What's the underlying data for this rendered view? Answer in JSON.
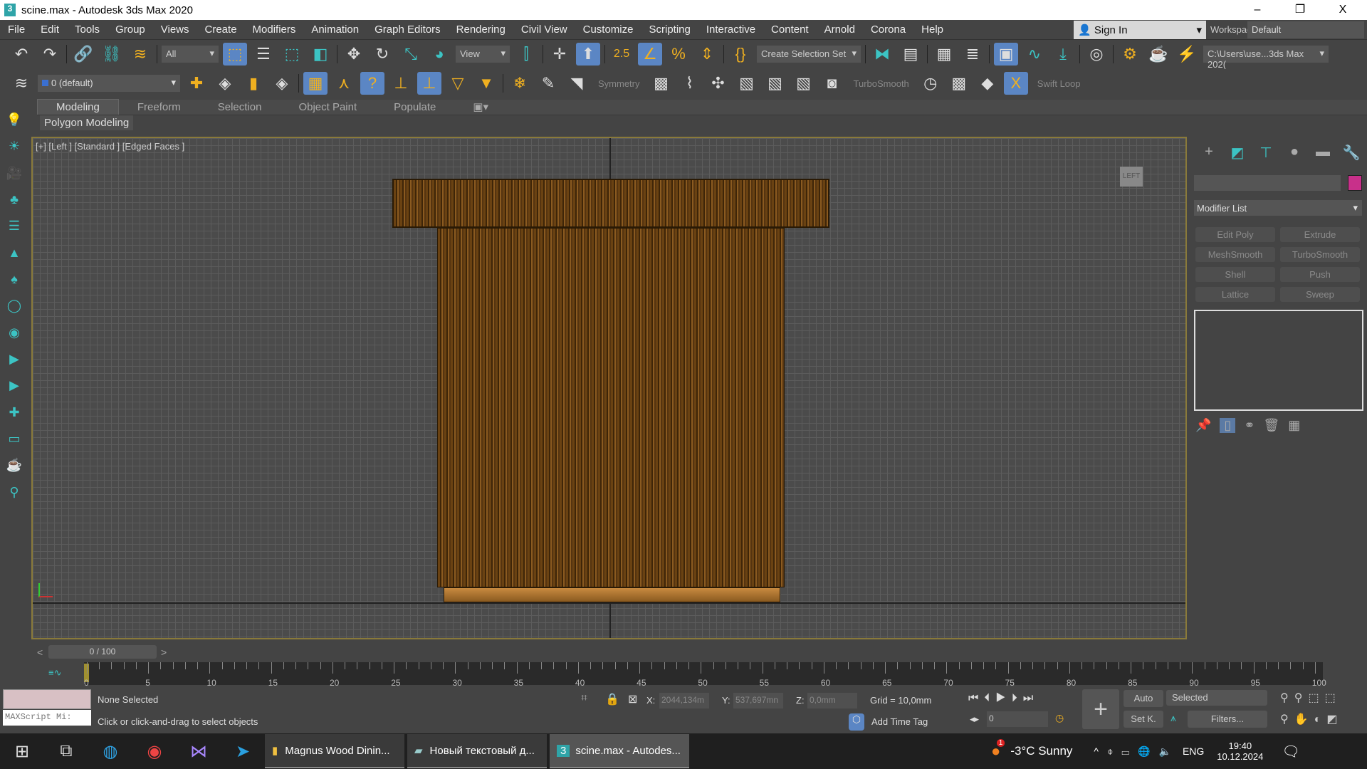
{
  "window": {
    "title": "scine.max - Autodesk 3ds Max 2020",
    "logo": "3",
    "minimize": "–",
    "restore": "❐",
    "close": "X"
  },
  "menu": [
    "File",
    "Edit",
    "Tools",
    "Group",
    "Views",
    "Create",
    "Modifiers",
    "Animation",
    "Graph Editors",
    "Rendering",
    "Civil View",
    "Customize",
    "Scripting",
    "Interactive",
    "Content",
    "Arnold",
    "Corona",
    "Help"
  ],
  "account": {
    "sign_in": "Sign In",
    "workspaces_label": "Workspaces:",
    "workspace": "Default"
  },
  "toolbar": {
    "filter": "All",
    "ref_coord": "View",
    "selection_set": "Create Selection Set",
    "project_path": "C:\\Users\\use...3ds Max 202(",
    "snap_2_5": "2.5"
  },
  "toolbar2": {
    "layer": "0 (default)",
    "symmetry": "Symmetry",
    "turbosmooth": "TurboSmooth",
    "swift_loop": "Swift Loop"
  },
  "ribbon": {
    "tabs": [
      "Modeling",
      "Freeform",
      "Selection",
      "Object Paint",
      "Populate"
    ],
    "active": "Modeling",
    "panel": "Polygon Modeling"
  },
  "viewport": {
    "label": "[+] [Left ] [Standard ] [Edged Faces ]",
    "viewcube": "LEFT"
  },
  "command_panel": {
    "modifier_list": "Modifier List",
    "color": "#c8308a",
    "buttons": [
      "Edit Poly",
      "Extrude",
      "MeshSmooth",
      "TurboSmooth",
      "Shell",
      "Push",
      "Lattice",
      "Sweep"
    ]
  },
  "time": {
    "slider": "0 / 100",
    "ticks": [
      "0",
      "5",
      "10",
      "15",
      "20",
      "25",
      "30",
      "35",
      "40",
      "45",
      "50",
      "55",
      "60",
      "65",
      "70",
      "75",
      "80",
      "85",
      "90",
      "95",
      "100"
    ]
  },
  "status": {
    "selection": "None Selected",
    "prompt": "Click or click-and-drag to select objects",
    "maxscript": "MAXScript Mi:",
    "x_label": "X:",
    "x": "2044,134m",
    "y_label": "Y:",
    "y": "537,697mn",
    "z_label": "Z:",
    "z": "0,0mm",
    "grid": "Grid = 10,0mm",
    "add_time_tag": "Add Time Tag",
    "auto": "Auto",
    "set_key": "Set K.",
    "key_filter": "Selected",
    "filters": "Filters...",
    "frame": "0"
  },
  "taskbar": {
    "tasks": [
      "Magnus Wood Dinin...",
      "Новый текстовый д...",
      "scine.max - Autodes..."
    ],
    "weather": "-3°C  Sunny",
    "weather_badge": "1",
    "lang": "ENG",
    "time": "19:40",
    "date": "10.12.2024"
  }
}
